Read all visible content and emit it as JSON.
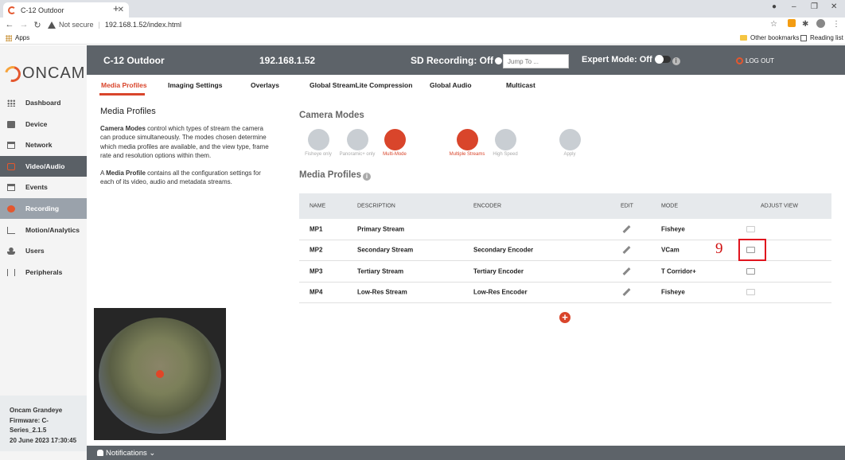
{
  "browser": {
    "tab_title": "C-12 Outdoor",
    "tab_close": "✕",
    "new_tab": "+",
    "not_secure": "Not secure",
    "url": "192.168.1.52/index.html",
    "apps_label": "Apps",
    "other_bookmarks": "Other bookmarks",
    "reading_list": "Reading list",
    "win_min": "–",
    "win_max": "❐",
    "win_close": "✕"
  },
  "brand": {
    "logo_text": "ONCAM"
  },
  "topbar": {
    "camera_name": "C-12 Outdoor",
    "ip": "192.168.1.52",
    "sd_recording": "SD Recording: Off",
    "jump_placeholder": "Jump To ...",
    "expert_mode": "Expert Mode: Off",
    "info": "i",
    "logout": "LOG OUT"
  },
  "sidebar": {
    "items": [
      {
        "label": "Dashboard"
      },
      {
        "label": "Device"
      },
      {
        "label": "Network"
      },
      {
        "label": "Video/Audio"
      },
      {
        "label": "Events"
      },
      {
        "label": "Recording"
      },
      {
        "label": "Motion/Analytics"
      },
      {
        "label": "Users"
      },
      {
        "label": "Peripherals"
      }
    ],
    "device_info": {
      "model": "Oncam Grandeye",
      "firmware": "Firmware: C-",
      "series": "Series_2.1.5",
      "datetime": "20 June 2023 17:30:45"
    }
  },
  "subnav": {
    "tabs": [
      {
        "label": "Media Profiles"
      },
      {
        "label": "Imaging Settings"
      },
      {
        "label": "Overlays"
      },
      {
        "label": "Global StreamLite Compression"
      },
      {
        "label": "Global Audio"
      },
      {
        "label": "Multicast"
      }
    ]
  },
  "description": {
    "title": "Media Profiles",
    "p1_bold": "Camera Modes",
    "p1_rest": " control which types of stream the camera can produce simultaneously. The modes chosen determine which media profiles are available, and the view type, frame rate and resolution options within them.",
    "p2_a": "A ",
    "p2_bold": "Media Profile",
    "p2_rest": " contains all the configuration settings for each of its video, audio and metadata streams."
  },
  "camera_modes": {
    "title": "Camera Modes",
    "modes": [
      {
        "label": "Fisheye only"
      },
      {
        "label": "Panoramic+ only"
      },
      {
        "label": "Multi-Mode"
      },
      {
        "label": "Multiple Streams"
      },
      {
        "label": "High Speed"
      },
      {
        "label": "Apply"
      }
    ]
  },
  "media_profiles": {
    "title": "Media Profiles",
    "info": "i",
    "headers": {
      "name": "NAME",
      "description": "DESCRIPTION",
      "encoder": "ENCODER",
      "edit": "EDIT",
      "mode": "MODE",
      "adjust": "ADJUST VIEW"
    },
    "rows": [
      {
        "name": "MP1",
        "description": "Primary Stream",
        "encoder": "",
        "mode": "Fisheye"
      },
      {
        "name": "MP2",
        "description": "Secondary Stream",
        "encoder": "Secondary Encoder",
        "mode": "VCam"
      },
      {
        "name": "MP3",
        "description": "Tertiary Stream",
        "encoder": "Tertiary Encoder",
        "mode": "T Corridor+"
      },
      {
        "name": "MP4",
        "description": "Low-Res Stream",
        "encoder": "Low-Res Encoder",
        "mode": "Fisheye"
      }
    ],
    "add": "+"
  },
  "annotation": {
    "step_number": "9"
  },
  "footer": {
    "notifications": "Notifications ⌄"
  }
}
